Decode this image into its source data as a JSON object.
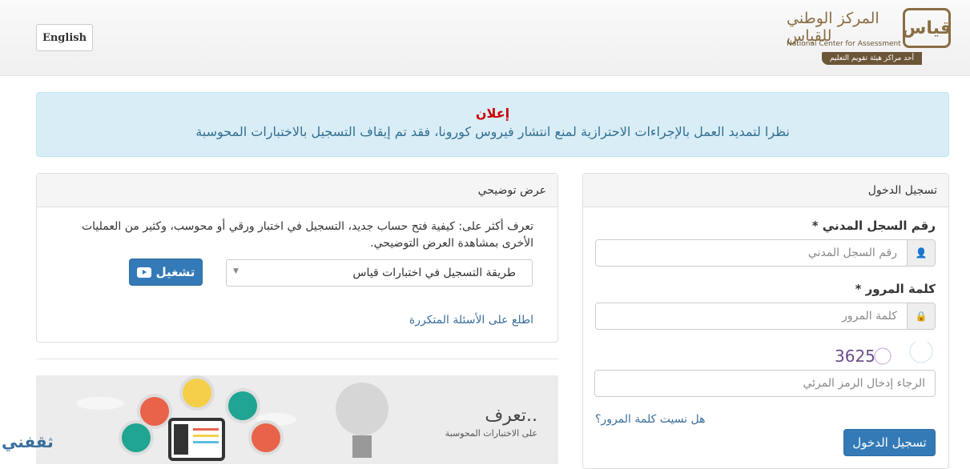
{
  "header": {
    "language_button": "English",
    "logo": {
      "arabic": "المركز الوطني للقياس",
      "english": "National Center for Assessment",
      "ribbon": "أحد مراكز هيئة تقويم التعليم",
      "mark": "قياس"
    }
  },
  "announcement": {
    "title": "إعلان",
    "message": "نظرا لتمديد العمل بالإجراءات الاحترازية لمنع انتشار فيروس كورونا، فقد تم إيقاف التسجيل بالاختبارات المحوسبة"
  },
  "demo": {
    "title": "عرض توضيحي",
    "description": "تعرف أكثر على: كيفية فتح حساب جديد، التسجيل في اختبار ورقي أو محوسب، وكثير من العمليات الأخرى بمشاهدة العرض التوضيحي.",
    "selected_video": "طريقة التسجيل في اختبارات قياس",
    "play_label": "تشغيل",
    "faq_link": "اطلع على الأسئلة المتكررة"
  },
  "banner": {
    "title": "تعرف..",
    "subtitle": "على الاختبارات المحوسبة",
    "watermark": "ثقفني"
  },
  "login": {
    "title": "تسجيل الدخول",
    "id_label": "رقم السجل المدني *",
    "id_placeholder": "رقم السجل المدني",
    "password_label": "كلمة المرور *",
    "password_placeholder": "كلمة المرور",
    "captcha_text": "3625",
    "captcha_placeholder": "الرجاء إدخال الرمز المرئي",
    "forgot_link": "هل نسيت كلمة المرور؟",
    "submit_label": "تسجيل الدخول"
  },
  "colors": {
    "primary": "#337ab7",
    "alert_bg": "#d9edf7",
    "alert_title": "#cc0000",
    "brand": "#8a6d45"
  }
}
